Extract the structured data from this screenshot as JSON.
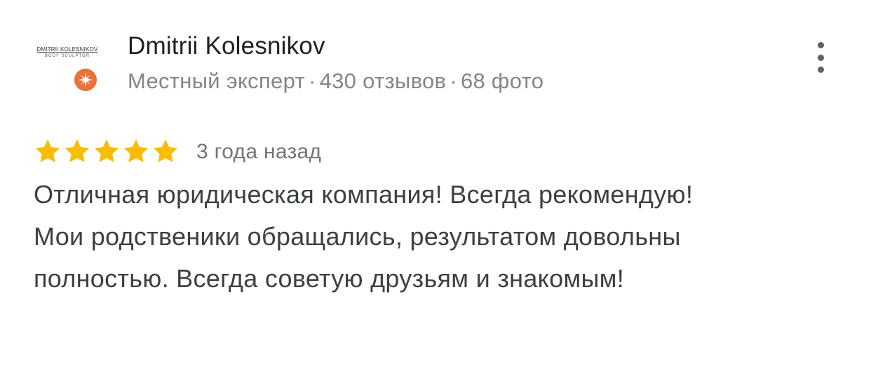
{
  "review": {
    "avatar": {
      "logo_line1": "DMITRII KOLESNIKOV",
      "logo_line2": "BODY SCULPTOR",
      "badge_icon": "local-guide-star-icon",
      "badge_color": "#e8713c"
    },
    "reviewer_name": "Dmitrii Kolesnikov",
    "meta": {
      "status": "Местный эксперт",
      "separator": "·",
      "reviews": "430 отзывов",
      "photos": "68 фото"
    },
    "more_icon": "more-vertical-icon",
    "rating": 5,
    "rating_max": 5,
    "star_color": "#fbbc04",
    "date": "3 года назад",
    "text": "Отличная юридическая компания! Всегда рекомендую! Мои родственики обращались, результатом довольны полностью. Всегда советую друзьям и знакомым!"
  }
}
